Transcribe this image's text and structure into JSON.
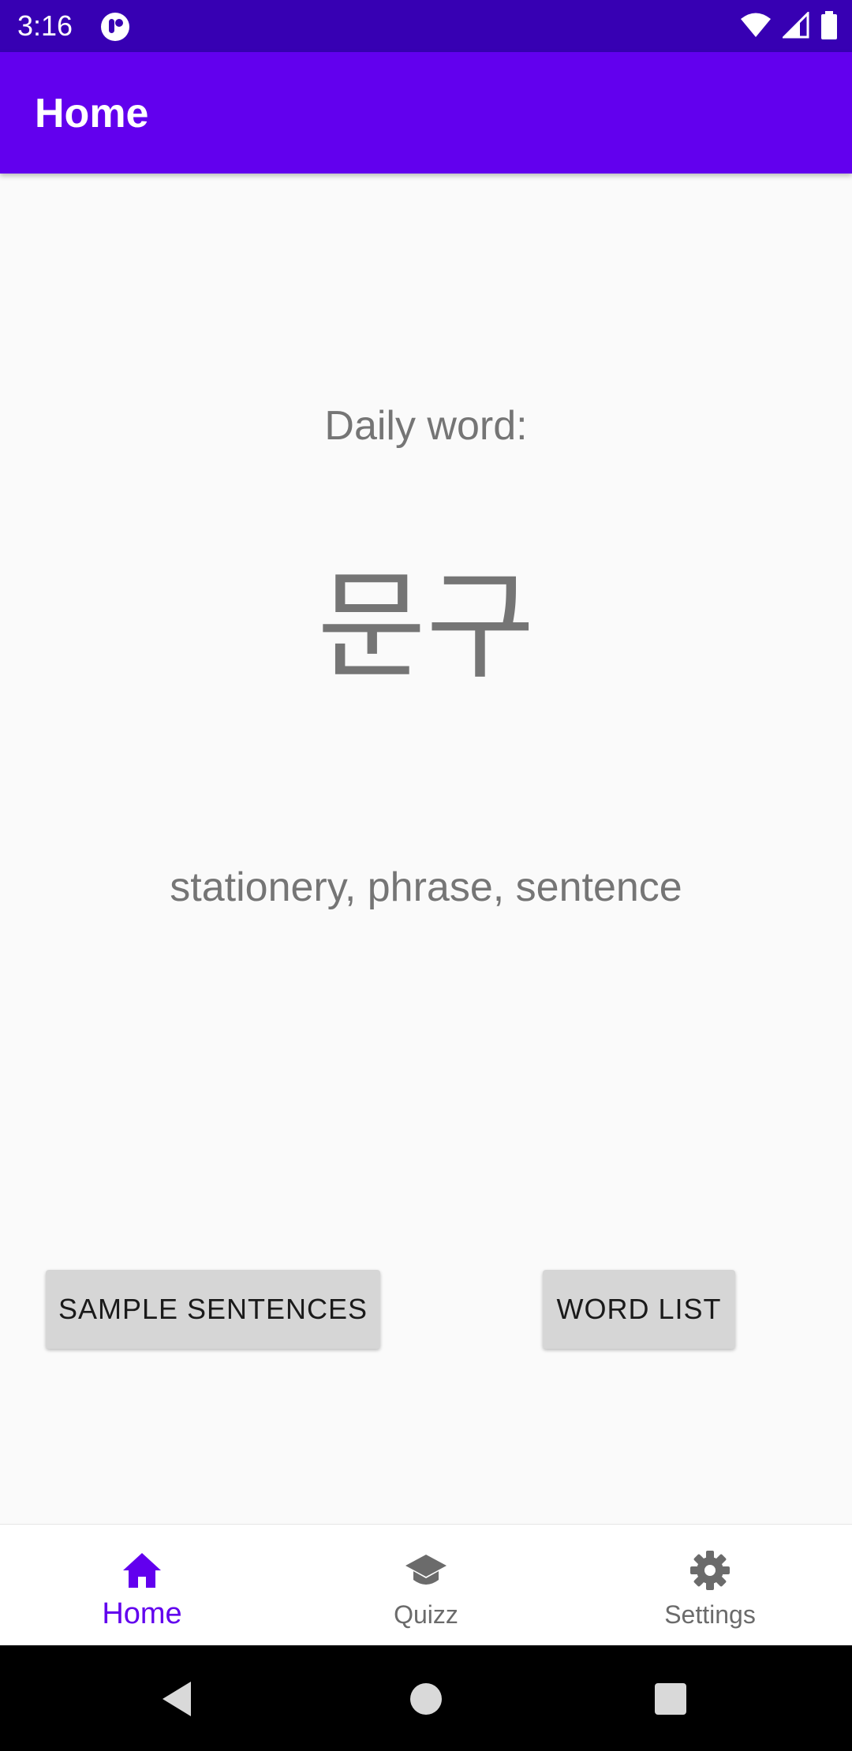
{
  "status_bar": {
    "time": "3:16",
    "app_icon": "app-notification-icon",
    "icons": [
      "wifi-icon",
      "signal-icon",
      "battery-icon"
    ],
    "background": "#3700B3"
  },
  "app_bar": {
    "title": "Home",
    "background": "#6200EE"
  },
  "main": {
    "daily_label": "Daily word:",
    "word": "문구",
    "meaning": "stationery, phrase, sentence",
    "buttons": {
      "sample_sentences": "SAMPLE SENTENCES",
      "word_list": "WORD LIST"
    }
  },
  "bottom_nav": {
    "items": [
      {
        "label": "Home",
        "icon": "home-icon",
        "active": true
      },
      {
        "label": "Quizz",
        "icon": "graduation-cap-icon",
        "active": false
      },
      {
        "label": "Settings",
        "icon": "gear-icon",
        "active": false
      }
    ],
    "active_color": "#6200EE",
    "inactive_color": "#6b6b6b"
  },
  "system_nav": {
    "icons": [
      "back-icon",
      "home-circle-icon",
      "recents-icon"
    ]
  }
}
